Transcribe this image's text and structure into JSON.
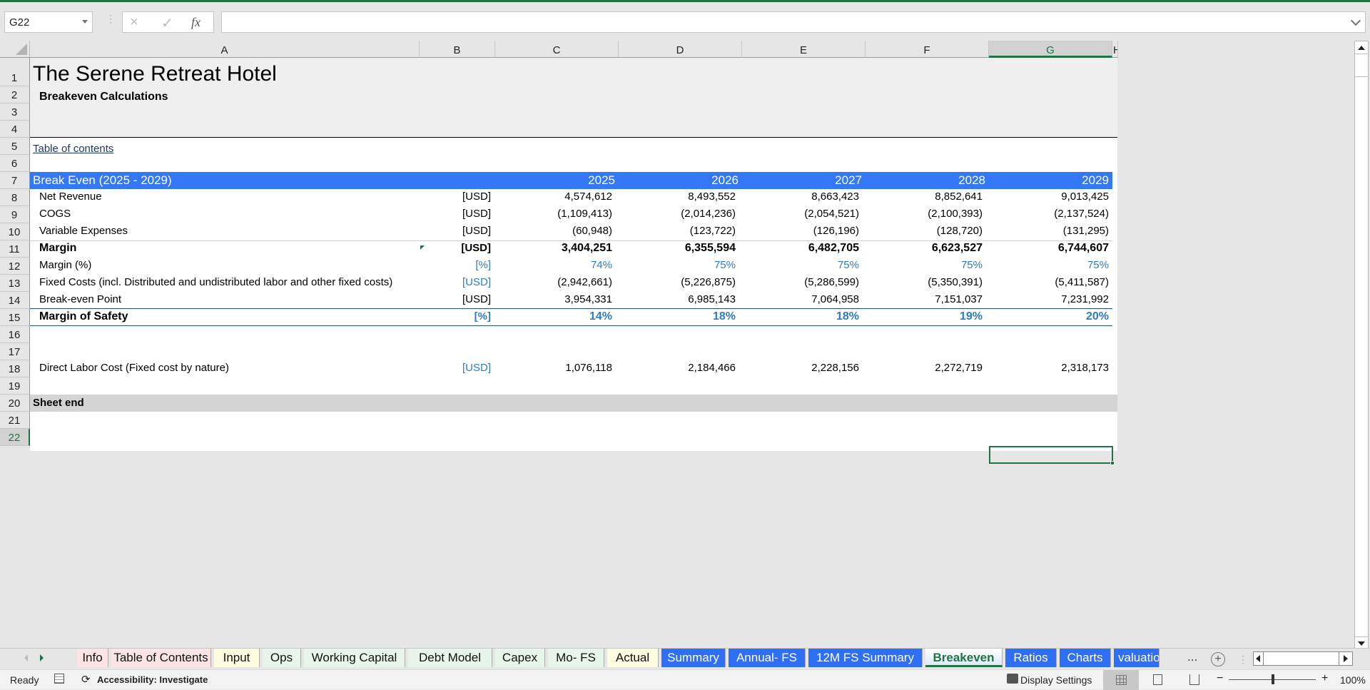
{
  "app": {
    "accent": "#217346",
    "header_band_color": "#3478f6"
  },
  "formula_bar": {
    "name_box": "G22",
    "cancel_icon": "×",
    "enter_icon": "✓",
    "fx_label": "fx",
    "formula_value": ""
  },
  "columns": [
    "A",
    "B",
    "C",
    "D",
    "E",
    "F",
    "G",
    "H"
  ],
  "rows": [
    "1",
    "2",
    "3",
    "4",
    "5",
    "6",
    "7",
    "8",
    "9",
    "10",
    "11",
    "12",
    "13",
    "14",
    "15",
    "16",
    "17",
    "18",
    "19",
    "20",
    "21",
    "22"
  ],
  "sheet": {
    "title": "The Serene Retreat Hotel",
    "subtitle": "Breakeven Calculations",
    "toc_link": "Table of contents",
    "section_header": {
      "label": "Break Even (2025 - 2029)",
      "years": [
        "2025",
        "2026",
        "2027",
        "2028",
        "2029"
      ]
    },
    "table_rows": [
      {
        "label": "Net Revenue",
        "unit": "[USD]",
        "values": [
          "4,574,612",
          "8,493,552",
          "8,663,423",
          "8,852,641",
          "9,013,425"
        ]
      },
      {
        "label": "COGS",
        "unit": "[USD]",
        "values": [
          "(1,109,413)",
          "(2,014,236)",
          "(2,054,521)",
          "(2,100,393)",
          "(2,137,524)"
        ]
      },
      {
        "label": "Variable Expenses",
        "unit": "[USD]",
        "values": [
          "(60,948)",
          "(123,722)",
          "(126,196)",
          "(128,720)",
          "(131,295)"
        ]
      },
      {
        "label": "Margin",
        "unit": "[USD]",
        "values": [
          "3,404,251",
          "6,355,594",
          "6,482,705",
          "6,623,527",
          "6,744,607"
        ]
      },
      {
        "label": "Margin (%)",
        "unit": "[%]",
        "values": [
          "74%",
          "75%",
          "75%",
          "75%",
          "75%"
        ]
      },
      {
        "label": "Fixed Costs (incl. Distributed and undistributed labor and other fixed costs)",
        "unit": "[USD]",
        "values": [
          "(2,942,661)",
          "(5,226,875)",
          "(5,286,599)",
          "(5,350,391)",
          "(5,411,587)"
        ]
      },
      {
        "label": "Break-even Point",
        "unit": "[USD]",
        "values": [
          "3,954,331",
          "6,985,143",
          "7,064,958",
          "7,151,037",
          "7,231,992"
        ]
      },
      {
        "label": "Margin of Safety",
        "unit": "[%]",
        "values": [
          "14%",
          "18%",
          "18%",
          "19%",
          "20%"
        ]
      }
    ],
    "direct_labor": {
      "label": "Direct Labor Cost (Fixed  cost by nature)",
      "unit": "[USD]",
      "values": [
        "1,076,118",
        "2,184,466",
        "2,228,156",
        "2,272,719",
        "2,318,173"
      ]
    },
    "sheet_end": "Sheet end"
  },
  "tabs": [
    {
      "label": "Info",
      "color": "#fde4e4"
    },
    {
      "label": "Table of Contents",
      "color": "#fde4e4"
    },
    {
      "label": "Input",
      "color": "#fefbe0"
    },
    {
      "label": "Ops",
      "color": "#e8f5ea"
    },
    {
      "label": "Working Capital",
      "color": "#e8f5ea"
    },
    {
      "label": "Debt Model",
      "color": "#e8f5ea"
    },
    {
      "label": "Capex",
      "color": "#e8f5ea"
    },
    {
      "label": "Mo- FS",
      "color": "#e8f5ea"
    },
    {
      "label": "Actual",
      "color": "#fefbe0"
    },
    {
      "label": "Summary",
      "color": "#2f6ff5"
    },
    {
      "label": "Annual- FS",
      "color": "#2f6ff5"
    },
    {
      "label": "12M FS Summary",
      "color": "#2f6ff5"
    },
    {
      "label": "Breakeven",
      "color": "active"
    },
    {
      "label": "Ratios",
      "color": "#2f6ff5"
    },
    {
      "label": "Charts",
      "color": "#2f6ff5"
    },
    {
      "label": "valuatio",
      "color": "#2f6ff5"
    }
  ],
  "tab_overflow": "...",
  "add_sheet": "+",
  "status": {
    "ready": "Ready",
    "accessibility": "Accessibility: Investigate",
    "display_settings": "Display Settings",
    "zoom_level": "100%",
    "zoom_minus": "−",
    "zoom_plus": "+"
  }
}
